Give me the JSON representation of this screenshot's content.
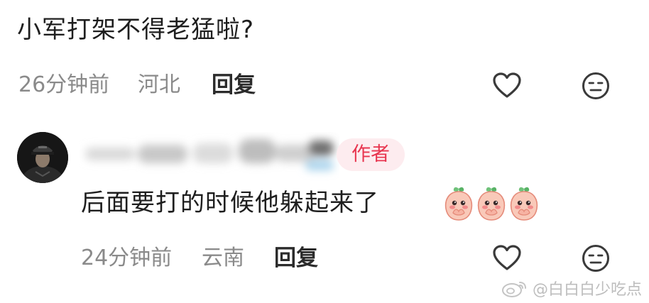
{
  "comment1": {
    "text": "小军打架不得老猛啦?",
    "time": "26分钟前",
    "location": "河北",
    "reply_label": "回复"
  },
  "comment2": {
    "author_badge": "作者",
    "text": "后面要打的时候他躲起来了",
    "emojis": [
      "shy-peach-emoji",
      "shy-peach-emoji",
      "shy-peach-emoji"
    ],
    "time": "24分钟前",
    "location": "云南",
    "reply_label": "回复"
  },
  "watermark": {
    "text": "@白白白少吃点",
    "icon": "weibo-logo"
  },
  "colors": {
    "author_badge_bg": "#fdecef",
    "author_badge_text": "#e8354f",
    "meta_text": "#8a8a8a",
    "icon_stroke": "#3a3a3a"
  }
}
